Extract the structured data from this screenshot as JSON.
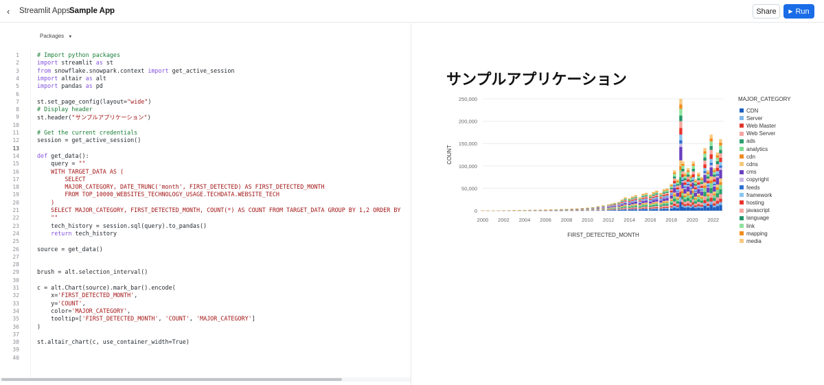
{
  "topbar": {
    "back_icon": "chevron-left-icon",
    "breadcrumb": "Streamlit Apps",
    "app_name": "Sample App",
    "share_label": "Share",
    "run_label": "Run"
  },
  "editor": {
    "packages_label": "Packages",
    "active_line": 13,
    "lines": [
      "# Import python packages",
      "import streamlit as st",
      "from snowflake.snowpark.context import get_active_session",
      "import altair as alt",
      "import pandas as pd",
      "",
      "st.set_page_config(layout=\"wide\")",
      "# Display header",
      "st.header(\"サンプルアプリケーション\")",
      "",
      "# Get the current credentials",
      "session = get_active_session()",
      "",
      "def get_data():",
      "    query = \"\"\"",
      "    WITH TARGET_DATA AS (",
      "        SELECT",
      "        MAJOR_CATEGORY, DATE_TRUNC('month', FIRST_DETECTED) AS FIRST_DETECTED_MONTH",
      "        FROM TOP_10000_WEBSITES_TECHNOLOGY_USAGE.TECHDATA.WEBSITE_TECH",
      "    )",
      "    SELECT MAJOR_CATEGORY, FIRST_DETECTED_MONTH, COUNT(*) AS COUNT FROM TARGET_DATA GROUP BY 1,2 ORDER BY",
      "    \"\"\"",
      "    tech_history = session.sql(query).to_pandas()",
      "    return tech_history",
      "",
      "source = get_data()",
      "",
      "",
      "brush = alt.selection_interval()",
      "",
      "c = alt.Chart(source).mark_bar().encode(",
      "    x='FIRST_DETECTED_MONTH',",
      "    y='COUNT',",
      "    color='MAJOR_CATEGORY',",
      "    tooltip=['FIRST_DETECTED_MONTH', 'COUNT', 'MAJOR_CATEGORY']",
      ")",
      "",
      "st.altair_chart(c, use_container_width=True)",
      "",
      ""
    ]
  },
  "preview": {
    "header": "サンプルアプリケーション"
  },
  "chart_data": {
    "type": "bar",
    "stacked": true,
    "xlabel": "FIRST_DETECTED_MONTH",
    "ylabel": "COUNT",
    "legend_title": "MAJOR_CATEGORY",
    "legend_position": "right",
    "ylim": [
      0,
      250000
    ],
    "yticks": [
      "0",
      "50,000",
      "100,000",
      "150,000",
      "200,000",
      "250,000"
    ],
    "xticks": [
      "2000",
      "2002",
      "2004",
      "2006",
      "2008",
      "2010",
      "2012",
      "2014",
      "2016",
      "2018",
      "2020",
      "2022"
    ],
    "grid": true,
    "x_years": [
      2000,
      2000.5,
      2001,
      2001.5,
      2002,
      2002.5,
      2003,
      2003.5,
      2004,
      2004.5,
      2005,
      2005.5,
      2006,
      2006.5,
      2007,
      2007.5,
      2008,
      2008.5,
      2009,
      2009.5,
      2010,
      2010.5,
      2011,
      2011.5,
      2012,
      2012.3,
      2012.6,
      2013,
      2013.3,
      2013.6,
      2014,
      2014.3,
      2014.6,
      2015,
      2015.3,
      2015.6,
      2016,
      2016.3,
      2016.6,
      2017,
      2017.3,
      2017.6,
      2018,
      2018.3,
      2018.6,
      2018.9,
      2019.1,
      2019.3,
      2019.6,
      2019.9,
      2020.1,
      2020.3,
      2020.6,
      2020.9,
      2021.2,
      2021.5,
      2021.8,
      2022.1,
      2022.4,
      2022.7
    ],
    "totals": [
      500,
      600,
      700,
      800,
      900,
      1000,
      1200,
      1400,
      1500,
      1800,
      2000,
      2200,
      2500,
      2800,
      3000,
      3500,
      4000,
      4500,
      5000,
      6000,
      7000,
      8000,
      10000,
      12000,
      14000,
      16000,
      18000,
      20000,
      25000,
      30000,
      28000,
      32000,
      35000,
      30000,
      38000,
      40000,
      36000,
      42000,
      45000,
      40000,
      48000,
      50000,
      60000,
      90000,
      70000,
      250000,
      110000,
      85000,
      95000,
      80000,
      110000,
      70000,
      85000,
      75000,
      140000,
      90000,
      170000,
      95000,
      130000,
      160000
    ],
    "categories": [
      "CDN",
      "Server",
      "Web Master",
      "Web Server",
      "ads",
      "analytics",
      "cdn",
      "cdns",
      "cms",
      "copyright",
      "feeds",
      "framework",
      "hosting",
      "javascript",
      "language",
      "link",
      "mapping",
      "media"
    ],
    "colors": [
      "#1f5fbf",
      "#7fb6e8",
      "#e03a2f",
      "#f3a4a4",
      "#2aa06e",
      "#7fdc91",
      "#f08a24",
      "#f4c77a",
      "#6b3fbf",
      "#c9b8e4",
      "#2f6fce",
      "#8ac6f2",
      "#e8352c",
      "#f7a6a0",
      "#23956b",
      "#8fe39d",
      "#f28c1f",
      "#f7c97e"
    ]
  }
}
